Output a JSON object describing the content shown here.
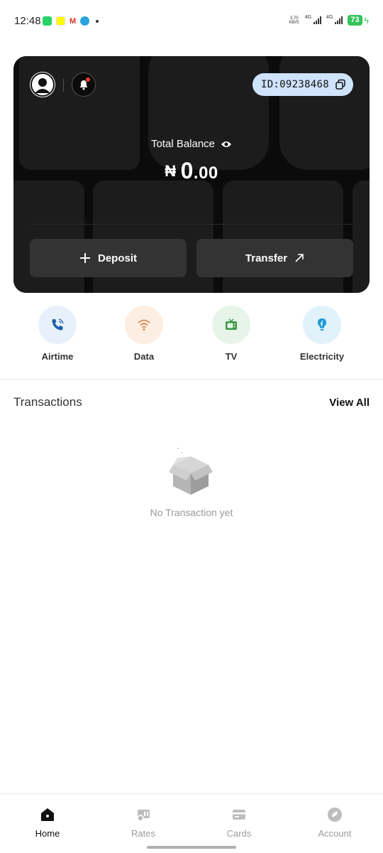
{
  "status_bar": {
    "time": "12:48",
    "app_icons": [
      "whatsapp-icon",
      "snapchat-icon",
      "gmail-icon",
      "telegram-icon"
    ],
    "net_speed": "3.70",
    "net_unit": "KB/S",
    "network_1": "4G",
    "network_2": "4G",
    "battery": "73"
  },
  "card": {
    "id_prefix": "ID:",
    "id_value": "09238468",
    "total_balance_label": "Total Balance",
    "currency_symbol": "₦",
    "balance_whole": "0",
    "balance_decimal": ".00",
    "deposit_label": "Deposit",
    "transfer_label": "Transfer"
  },
  "quick_actions": [
    {
      "label": "Airtime",
      "icon": "phone-icon",
      "bg": "#e8f1fb",
      "color": "#1f5fa8"
    },
    {
      "label": "Data",
      "icon": "wifi-icon",
      "bg": "#fdeee3",
      "color": "#d98a4a"
    },
    {
      "label": "TV",
      "icon": "tv-icon",
      "bg": "#e7f4e8",
      "color": "#3c9a48"
    },
    {
      "label": "Electricity",
      "icon": "bulb-icon",
      "bg": "#e1f2fb",
      "color": "#1e9bd7"
    }
  ],
  "transactions": {
    "title": "Transactions",
    "view_all": "View All",
    "empty_message": "No Transaction yet"
  },
  "bottom_nav": [
    {
      "label": "Home",
      "icon": "home-icon",
      "active": true
    },
    {
      "label": "Rates",
      "icon": "rates-icon",
      "active": false
    },
    {
      "label": "Cards",
      "icon": "card-icon",
      "active": false
    },
    {
      "label": "Account",
      "icon": "account-icon",
      "active": false
    }
  ],
  "colors": {
    "card_bg": "#0b0b0b",
    "id_pill": "#cfe3fb",
    "button_dark": "#333333",
    "battery_green": "#35c35a",
    "notification_red": "#ff3b30"
  }
}
